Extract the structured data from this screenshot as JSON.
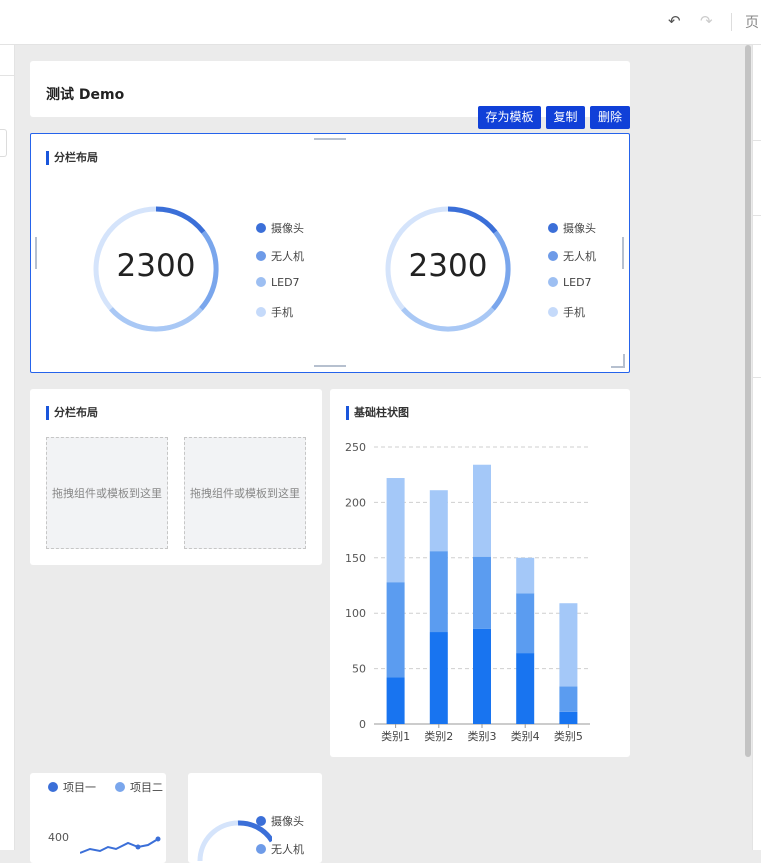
{
  "toolbar": {
    "undo_icon": "undo-icon",
    "redo_icon": "redo-icon",
    "page_label": "页"
  },
  "page": {
    "title": "测试 Demo"
  },
  "actions": {
    "save_template": "存为模板",
    "copy": "复制",
    "delete": "删除"
  },
  "split_layout_selected": {
    "title": "分栏布局",
    "columns": [
      {
        "value": "2300",
        "legend": [
          "摄像头",
          "无人机",
          "LED7",
          "手机"
        ]
      },
      {
        "value": "2300",
        "legend": [
          "摄像头",
          "无人机",
          "LED7",
          "手机"
        ]
      }
    ]
  },
  "split_layout_empty": {
    "title": "分栏布局",
    "drop_zones": [
      "拖拽组件或模板到这里",
      "拖拽组件或模板到这里"
    ]
  },
  "bar_chart": {
    "title": "基础柱状图"
  },
  "line_chart_partial": {
    "legend": [
      "项目一",
      "项目二"
    ],
    "tick_label": "400"
  },
  "donut_partial": {
    "legend": [
      "摄像头",
      "无人机"
    ]
  },
  "colors": {
    "accent": "#1040d8",
    "series": [
      "#1874f0",
      "#5b9cf0",
      "#a4c8f8"
    ],
    "legend_dots": [
      "#3b6fd8",
      "#6e9be8",
      "#9dbff2",
      "#c5dafa"
    ]
  },
  "chart_data": {
    "type": "bar",
    "stacked": true,
    "title": "基础柱状图",
    "categories": [
      "类别1",
      "类别2",
      "类别3",
      "类别4",
      "类别5"
    ],
    "series": [
      {
        "values": [
          42,
          83,
          86,
          64,
          11
        ]
      },
      {
        "values": [
          86,
          73,
          65,
          54,
          23
        ]
      },
      {
        "values": [
          94,
          55,
          83,
          32,
          75
        ]
      }
    ],
    "ylim": [
      0,
      250
    ],
    "yticks": [
      0,
      50,
      100,
      150,
      200,
      250
    ],
    "grid": true
  }
}
